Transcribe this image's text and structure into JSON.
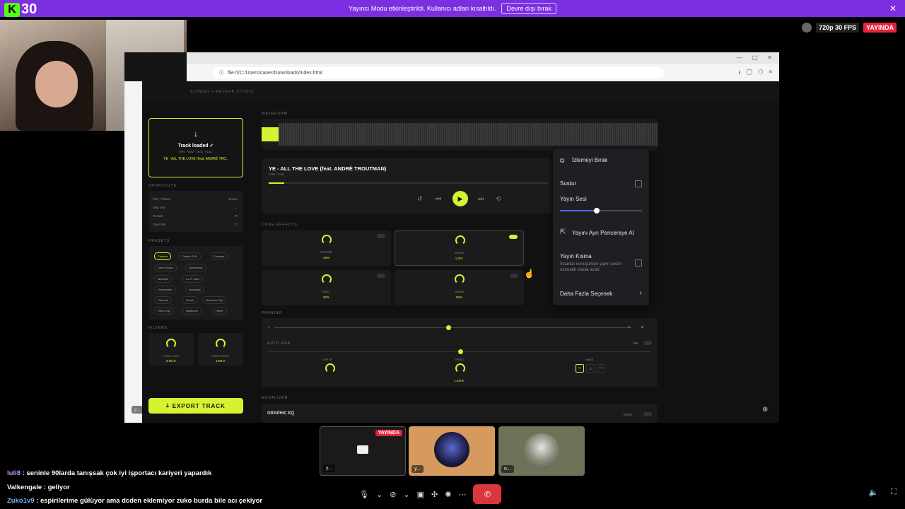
{
  "banner": {
    "message": "Yayıncı Modu etkinleştirildi. Kullanıcı adları kısaltıldı.",
    "button": "Devre dışı bırak",
    "close": "✕"
  },
  "logo": {
    "letter": "K",
    "number": "30"
  },
  "status": {
    "fps": "720p 30 FPS",
    "live": "YAYINDA"
  },
  "browser": {
    "url": "file:///C:/Users/caner/Downloads/index.html",
    "win_controls": [
      "—",
      "▢",
      "✕"
    ]
  },
  "app": {
    "header_title": "SLOWED + REVERB STUDIO",
    "drop": {
      "arrow": "↓",
      "title": "Track loaded ✓",
      "formats": "MP3 · WAV · OGG · FLAC",
      "filename": "YE - ALL THE LOVE (feat. ANDRÉ TRO.."
    },
    "shortcuts": {
      "label": "SHORTCUTS",
      "items": [
        {
          "name": "Play / Pause",
          "key": "Space"
        },
        {
          "name": "Skip ±5s",
          "key": "← →"
        },
        {
          "name": "Restart",
          "key": "R"
        },
        {
          "name": "Open file",
          "key": "O"
        }
      ]
    },
    "presets": {
      "label": "PRESETS",
      "items": [
        "Custom",
        "Classic S+R",
        "Dreamy",
        "Deep Space",
        "Vaporwave",
        "Midnight",
        "Lo-Fi Tape",
        "Underwater",
        "Nostalgia",
        "Ethereal",
        "Ghost",
        "Bedroom Pop",
        "Retro Day",
        "Nightcore",
        "Hyper"
      ]
    },
    "filters": {
      "label": "FILTERS",
      "low": {
        "name": "LOWS PASS",
        "value": "5.0kHz"
      },
      "high": {
        "name": "HIGHS PASS",
        "value": "100Hz"
      }
    },
    "export_label": "EXPORT TRACK",
    "export_icon": "⤓",
    "waveform_label": "WAVEFORM",
    "track": {
      "title": "YE - ALL THE LOVE (feat. ANDRÉ TROUTMAN)",
      "time": "0:00 / 3:45",
      "progress": 0.055
    },
    "controls": {
      "restart": "↺",
      "prev": "⏮",
      "play": "▶",
      "next": "⏭",
      "loop": "⟲"
    },
    "core_label": "CORE EFFECTS",
    "effects": [
      {
        "name": "REVERB",
        "value": "45%"
      },
      {
        "name": "SPEED",
        "value": "1.00×"
      },
      {
        "name": "VINYL",
        "value": "50%"
      },
      {
        "name": "WIDEN",
        "value": "50%"
      }
    ],
    "panning_label": "PANNING",
    "pan_l": "L",
    "pan_r": "R",
    "pan_c": "C",
    "autopan_label": "AUTO-PAN",
    "autopan_value": "0%",
    "pan_knobs": [
      {
        "name": "DEPTH",
        "value": ""
      },
      {
        "name": "SPEED",
        "value": "1.43Hz"
      }
    ],
    "wave_label": "WAVE",
    "equalizer_label": "EQUALIZER",
    "eq_title": "GRAPHIC EQ",
    "eq_reset": "Reset"
  },
  "menu": {
    "stop": "İzlemeyi Bırak",
    "mute": "Sustur",
    "volume_label": "Yayın Sesi",
    "volume": 0.45,
    "popout": "Yayını Ayrı Pencereye Al",
    "attenuation": "Yayın Kısma",
    "attenuation_desc": "İnsanlar konuşurken yayın sesini otomatik olarak azalt.",
    "more": "Daha Fazla Seçenek"
  },
  "screen_name": "y...",
  "participants": [
    {
      "name": "y...",
      "badge": "YAYINDA"
    },
    {
      "name": "y...",
      "badge": ""
    },
    {
      "name": "n...",
      "badge": ""
    }
  ],
  "chat": [
    {
      "user": "luli8",
      "text": " : seninle 90larda tanışsak çok iyi işportacı kariyeri yapardık",
      "color": "#c58af9"
    },
    {
      "user": "Valkengale",
      "text": " : geliyor",
      "color": "#ffffff"
    },
    {
      "user": "Zuko1v9",
      "text": " : espirilerime gülüyor ama dcden eklemiyor zuko burda bile acı çekiyor",
      "color": "#7cb8ff"
    }
  ],
  "colors": {
    "accent": "#d6f230",
    "banner": "#7b2fe0",
    "live": "#e5253c",
    "leave": "#da373c",
    "slider": "#5865f2"
  }
}
